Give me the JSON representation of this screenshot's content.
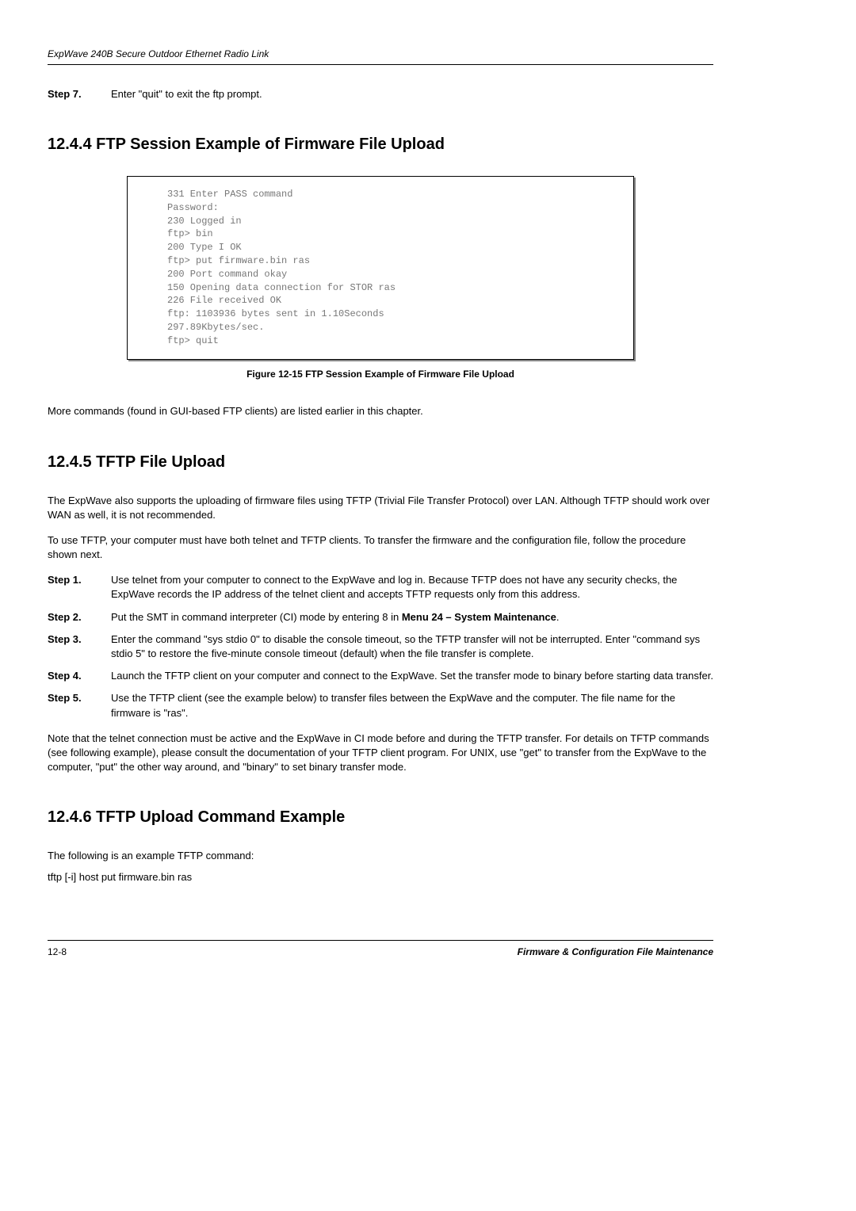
{
  "header": {
    "title": "ExpWave 240B Secure Outdoor Ethernet Radio Link"
  },
  "topStep": {
    "label": "Step 7.",
    "body": "Enter \"quit\" to exit the ftp prompt."
  },
  "section1": {
    "heading": "12.4.4 FTP Session Example of Firmware File Upload",
    "code": "331 Enter PASS command\nPassword:\n230 Logged in\nftp> bin\n200 Type I OK\nftp> put firmware.bin ras\n200 Port command okay\n150 Opening data connection for STOR ras\n226 File received OK\nftp: 1103936 bytes sent in 1.10Seconds\n297.89Kbytes/sec.\nftp> quit",
    "caption": "Figure 12-15 FTP Session Example of Firmware File Upload",
    "after": "More commands (found in GUI-based FTP clients) are listed earlier in this chapter."
  },
  "section2": {
    "heading": "12.4.5 TFTP File Upload",
    "p1": "The ExpWave also supports the uploading of firmware files using TFTP (Trivial File Transfer Protocol) over LAN. Although TFTP should work over WAN as well, it is not recommended.",
    "p2": "To use TFTP, your computer must have both telnet and TFTP clients. To transfer the firmware and the configuration file, follow the procedure shown next.",
    "steps": [
      {
        "label": "Step 1.",
        "body": "Use telnet from your computer to connect to the ExpWave and log in. Because TFTP does not have any security checks, the ExpWave records the IP address of the telnet client and accepts TFTP requests only from this address."
      },
      {
        "label": "Step 2.",
        "body_pre": "Put the SMT in command interpreter (CI) mode by entering 8 in ",
        "body_bold": "Menu 24 – System Maintenance",
        "body_post": "."
      },
      {
        "label": "Step 3.",
        "body": "Enter the command \"sys stdio 0\" to disable the console timeout, so the TFTP transfer will not be interrupted. Enter \"command sys stdio 5\" to restore the five-minute console timeout (default) when the file transfer is complete."
      },
      {
        "label": "Step 4.",
        "body": "Launch the TFTP client on your computer and connect to the ExpWave. Set the transfer mode to binary before starting data transfer."
      },
      {
        "label": "Step 5.",
        "body": "Use the TFTP client (see the example below) to transfer files between the ExpWave and the computer. The file name for the firmware is \"ras\"."
      }
    ],
    "p3": "Note that the telnet connection must be active and the ExpWave in CI mode before and during the TFTP transfer. For details on TFTP commands (see following example), please consult the documentation of your TFTP client program. For UNIX, use \"get\" to transfer from the ExpWave to the computer, \"put\" the other way around, and \"binary\" to set binary transfer mode."
  },
  "section3": {
    "heading": "12.4.6 TFTP Upload Command Example",
    "p1": "The following is an example TFTP command:",
    "p2": "tftp [-i] host put firmware.bin ras"
  },
  "footer": {
    "left": "12-8",
    "right": "Firmware & Configuration File Maintenance"
  }
}
